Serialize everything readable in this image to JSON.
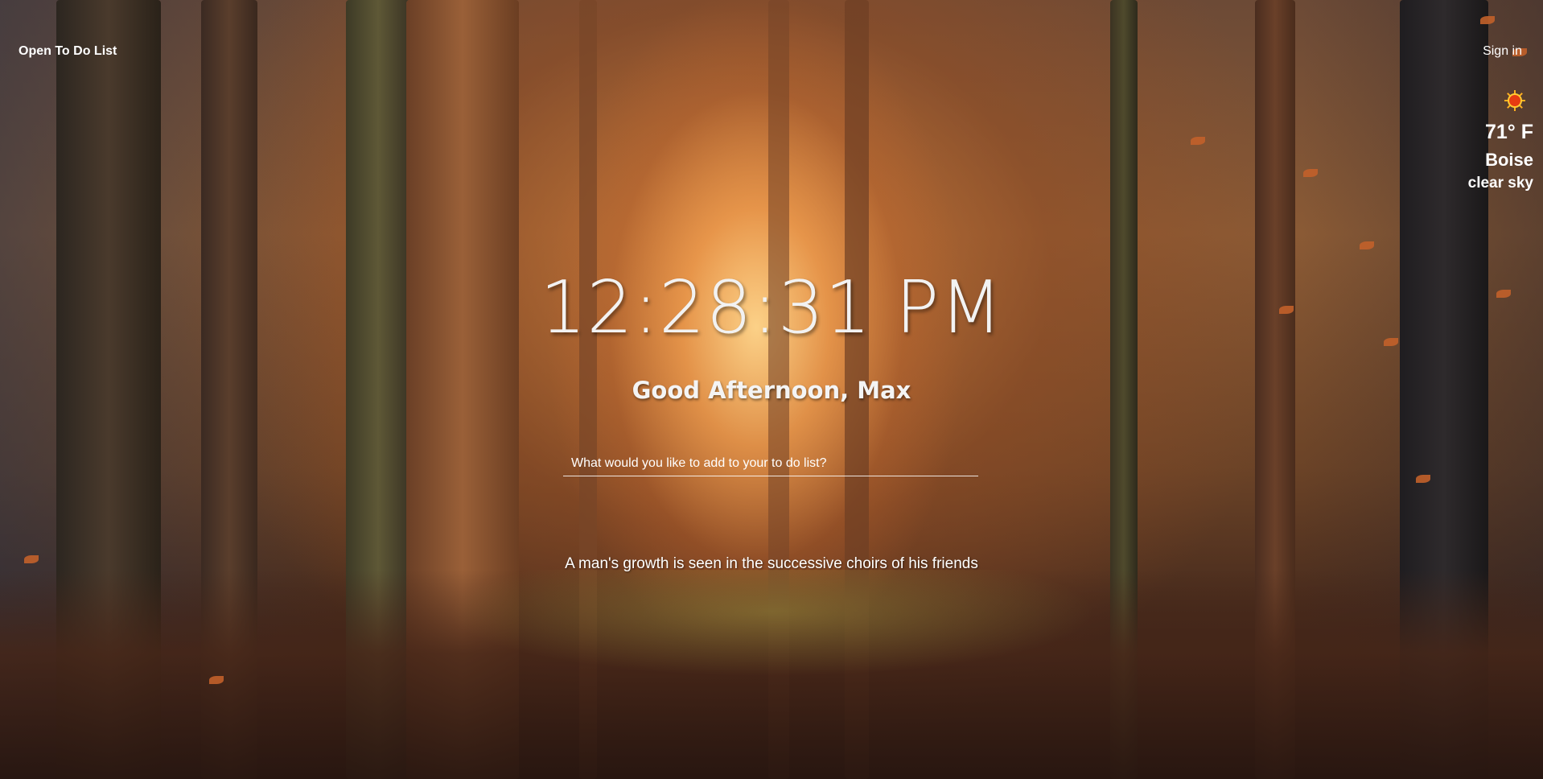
{
  "header": {
    "todo_link_label": "Open To Do List",
    "signin_label": "Sign in"
  },
  "weather": {
    "icon": "sun-icon",
    "temperature": "71° F",
    "city": "Boise",
    "description": "clear sky"
  },
  "clock": {
    "time": "12:28:31 PM"
  },
  "greeting": {
    "text": "Good Afternoon, Max"
  },
  "todo": {
    "placeholder": "What would you like to add to your to do list?",
    "value": ""
  },
  "quote": {
    "text": "A man's growth is seen in the successive choirs of his friends"
  },
  "colors": {
    "text": "#ffffff",
    "weather_icon": "#e63c12",
    "background_glow": "#f4a050"
  }
}
